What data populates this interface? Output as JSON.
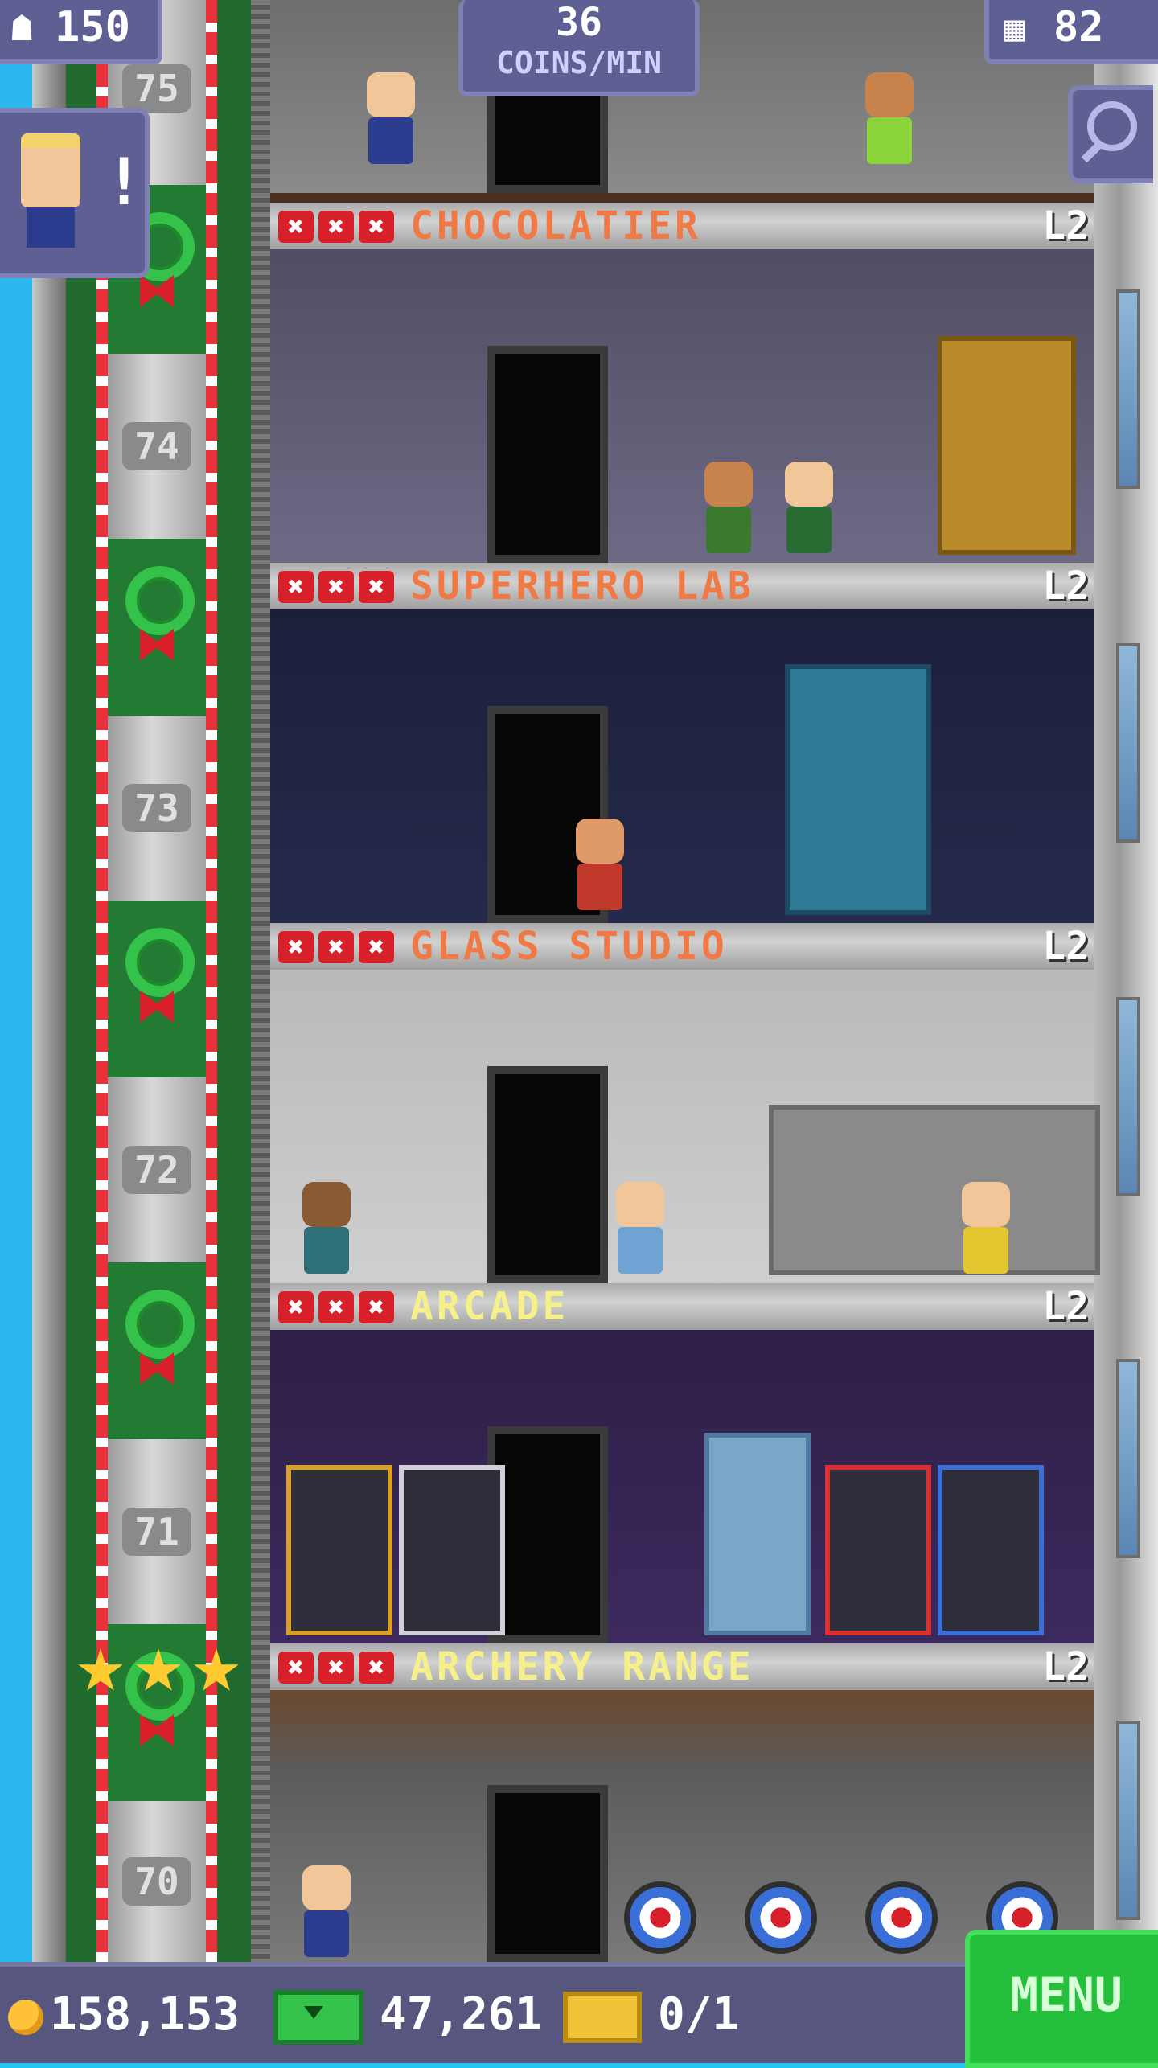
{
  "hud": {
    "population": "150",
    "coins_rate_value": "36",
    "coins_rate_unit": "COINS/MIN",
    "floors_count": "82"
  },
  "elevator": {
    "floor_numbers": [
      "75",
      "74",
      "73",
      "72",
      "71",
      "70"
    ]
  },
  "floors": [
    {
      "name": "CHOCOLATIER",
      "level": "L2",
      "name_color": "#f07a46"
    },
    {
      "name": "SUPERHERO LAB",
      "level": "L2",
      "name_color": "#f07a46"
    },
    {
      "name": "GLASS STUDIO",
      "level": "L2",
      "name_color": "#f07a46"
    },
    {
      "name": "ARCADE",
      "level": "L2",
      "name_color": "#f6f08a"
    },
    {
      "name": "ARCHERY RANGE",
      "level": "L2",
      "name_color": "#f6f08a"
    }
  ],
  "floor_xmark": "✖",
  "bottom_bar": {
    "coins": "158,153",
    "bux": "47,261",
    "tickets": "0/1",
    "menu_label": "MENU"
  },
  "colors": {
    "sky": "#27c2f0",
    "hud_purple": "#5e5f93",
    "menu_green": "#25c03b"
  }
}
